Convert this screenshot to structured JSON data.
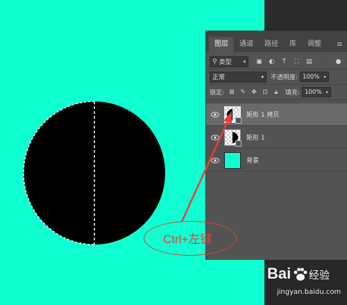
{
  "colors": {
    "canvas": "#0fffd2",
    "shape": "#000000",
    "panel": "#535353",
    "annotation": "#e8403a"
  },
  "panel": {
    "tabs": [
      "图层",
      "通道",
      "路径",
      "库",
      "调整"
    ],
    "active_tab": "图层",
    "menu_icon": "panel-menu-icon",
    "filter": {
      "kind_label": "类型",
      "icons": [
        "image-filter-icon",
        "adjustment-filter-icon",
        "type-filter-icon",
        "shape-filter-icon",
        "smart-object-filter-icon"
      ]
    },
    "blend_mode": "正常",
    "opacity_label": "不透明度:",
    "opacity_value": "100%",
    "lock_label": "锁定:",
    "lock_icons": [
      "lock-transparent-icon",
      "lock-pixels-icon",
      "lock-position-icon",
      "lock-artboard-icon",
      "lock-all-icon"
    ],
    "fill_label": "填充:",
    "fill_value": "100%",
    "layers": [
      {
        "name": "矩形 1 拷贝",
        "selected": true,
        "thumb": "shape"
      },
      {
        "name": "矩形 1",
        "selected": false,
        "thumb": "shape"
      },
      {
        "name": "背景",
        "selected": false,
        "thumb": "background"
      }
    ]
  },
  "annotation": {
    "text": "Ctrl+左键"
  },
  "watermark": {
    "logo_a": "Bai",
    "logo_b": "经验",
    "url": "jingyan.baidu.com"
  }
}
